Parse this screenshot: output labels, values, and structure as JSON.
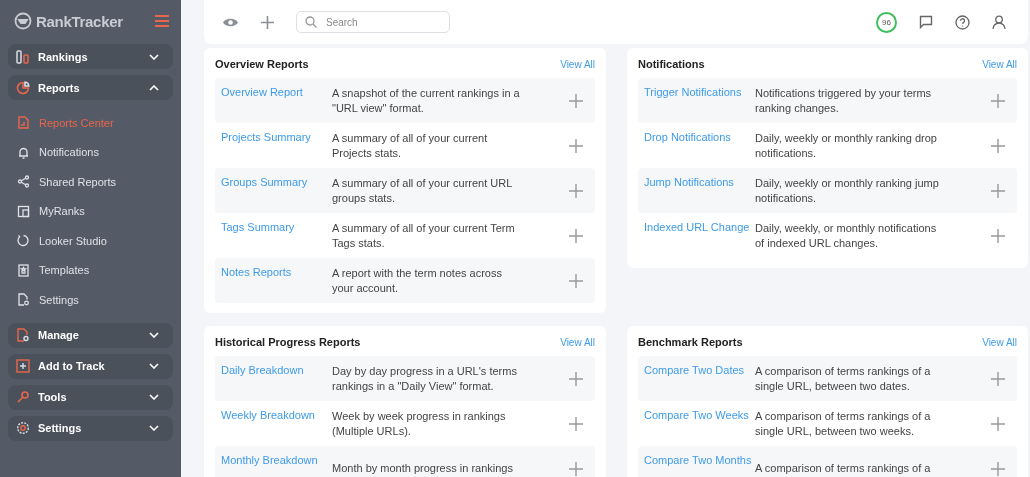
{
  "sidebar": {
    "logo": "RankTracker",
    "items": [
      {
        "kind": "group",
        "label": "Rankings",
        "expanded": false
      },
      {
        "kind": "group",
        "label": "Reports",
        "expanded": true,
        "children": [
          {
            "label": "Reports Center",
            "selected": true
          },
          {
            "label": "Notifications",
            "selected": false
          },
          {
            "label": "Shared Reports",
            "selected": false
          },
          {
            "label": "MyRanks",
            "selected": false
          },
          {
            "label": "Looker Studio",
            "selected": false
          },
          {
            "label": "Templates",
            "selected": false
          },
          {
            "label": "Settings",
            "selected": false
          }
        ]
      },
      {
        "kind": "group",
        "label": "Manage",
        "expanded": false
      },
      {
        "kind": "group",
        "label": "Add to Track",
        "expanded": false
      },
      {
        "kind": "group",
        "label": "Tools",
        "expanded": false
      },
      {
        "kind": "group",
        "label": "Settings",
        "expanded": false
      }
    ]
  },
  "topbar": {
    "search": {
      "placeholder": "Search"
    },
    "score": "96"
  },
  "cards": [
    {
      "title": "Overview Reports",
      "link": "View All",
      "rows": [
        {
          "name": "Overview Report",
          "description": "A snapshot of the current rankings in a \"URL view\" format."
        },
        {
          "name": "Projects Summary",
          "description": "A summary of all of your current Projects stats."
        },
        {
          "name": "Groups Summary",
          "description": "A summary of all of your current URL groups stats."
        },
        {
          "name": "Tags Summary",
          "description": "A summary of all of your current Term Tags stats."
        },
        {
          "name": "Notes Reports",
          "description": "A report with the term notes across your account."
        }
      ]
    },
    {
      "title": "Notifications",
      "link": "View All",
      "rows": [
        {
          "name": "Trigger Notifications",
          "description": "Notifications triggered by your terms ranking changes."
        },
        {
          "name": "Drop Notifications",
          "description": "Daily, weekly or monthly ranking drop notifications."
        },
        {
          "name": "Jump Notifications",
          "description": "Daily, weekly or monthly ranking jump notifications."
        },
        {
          "name": "Indexed URL Change",
          "description": "Daily, weekly, or monthly notifications of indexed URL changes."
        }
      ]
    },
    {
      "title": "Historical Progress Reports",
      "link": "View All",
      "rows": [
        {
          "name": "Daily Breakdown",
          "description": "Day by day progress in a URL's terms rankings in a \"Daily View\" format."
        },
        {
          "name": "Weekly Breakdown",
          "description": "Week by week progress in rankings (Multiple URLs)."
        },
        {
          "name": "Monthly Breakdown",
          "description": "Month by month progress in rankings"
        }
      ]
    },
    {
      "title": "Benchmark Reports",
      "link": "View All",
      "rows": [
        {
          "name": "Compare Two Dates",
          "description": "A comparison of terms rankings of a single URL, between two dates."
        },
        {
          "name": "Compare Two Weeks",
          "description": "A comparison of terms rankings of a single URL, between two weeks."
        },
        {
          "name": "Compare Two Months",
          "description": "A comparison of terms rankings of a"
        }
      ]
    }
  ]
}
